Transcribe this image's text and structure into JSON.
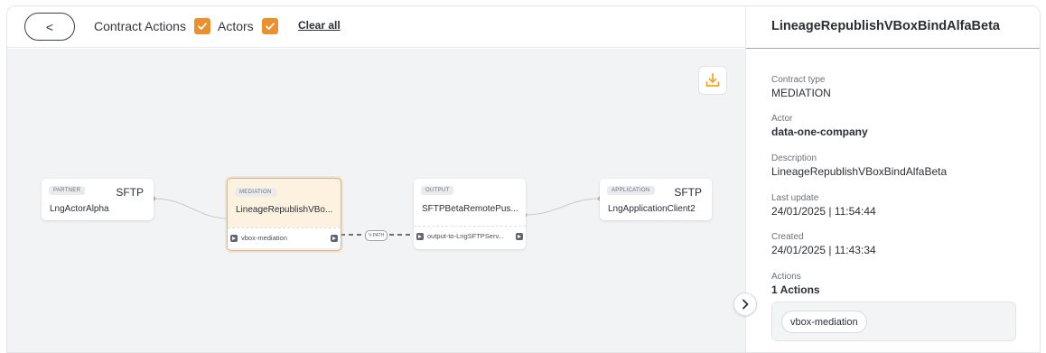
{
  "toolbar": {
    "back_label": "<",
    "filter_contract_actions": "Contract Actions",
    "filter_actors": "Actors",
    "clear_all": "Clear all"
  },
  "graph": {
    "nodes": [
      {
        "badge": "PARTNER",
        "protocol": "SFTP",
        "name": "LngActorAlpha"
      },
      {
        "badge": "MEDIATION",
        "name": "LineageRepublishVBo...",
        "action": "vbox-mediation"
      },
      {
        "badge": "OUTPUT",
        "name": "SFTPBetaRemotePus...",
        "action": "output-to-LngSFTPServ..."
      },
      {
        "badge": "APPLICATION",
        "protocol": "SFTP",
        "name": "LngApplicationClient2"
      }
    ],
    "edge_label": "V-PATH"
  },
  "panel": {
    "title": "LineageRepublishVBoxBindAlfaBeta",
    "fields": [
      {
        "label": "Contract type",
        "value": "MEDIATION"
      },
      {
        "label": "Actor",
        "value": "data-one-company"
      },
      {
        "label": "Description",
        "value": "LineageRepublishVBoxBindAlfaBeta"
      },
      {
        "label": "Last update",
        "value": "24/01/2025 | 11:54:44"
      },
      {
        "label": "Created",
        "value": "24/01/2025 | 11:43:34"
      },
      {
        "label": "Actions",
        "value": "1 Actions"
      }
    ],
    "action_chip": "vbox-mediation"
  },
  "colors": {
    "accent": "#ec8f2f",
    "canvas_bg": "#f2f3f5",
    "selected_node_bg": "#fdf2df",
    "selected_node_border": "#f1b25c"
  },
  "icons": {
    "download": "download-icon",
    "checkbox": "check-icon",
    "expand": "chevron-right-icon"
  }
}
